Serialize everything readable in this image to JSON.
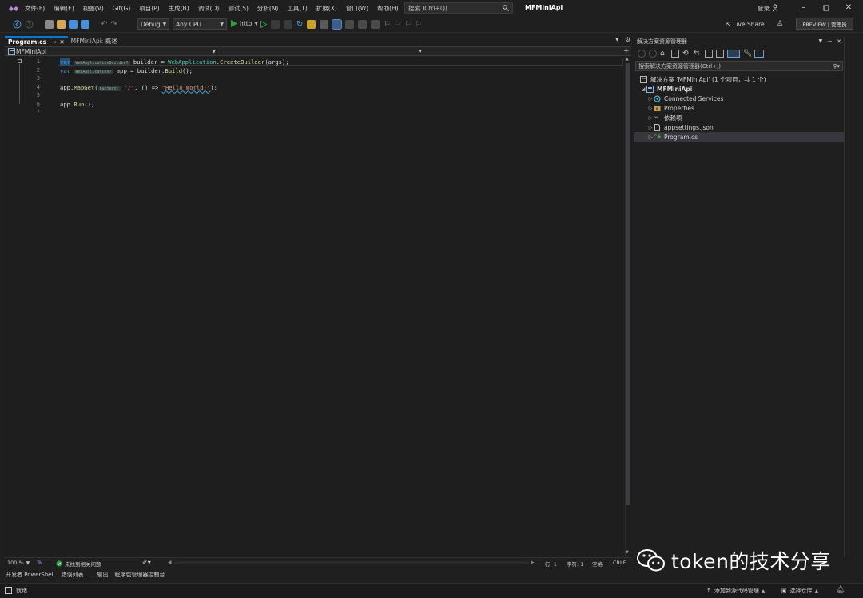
{
  "menu": [
    "文件(F)",
    "编辑(E)",
    "视图(V)",
    "Git(G)",
    "项目(P)",
    "生成(B)",
    "调试(D)",
    "测试(S)",
    "分析(N)",
    "工具(T)",
    "扩展(X)",
    "窗口(W)",
    "帮助(H)"
  ],
  "search": {
    "label": "搜索 (Ctrl+Q)"
  },
  "window": {
    "title": "MFMiniApi",
    "login_label": "登录"
  },
  "toolbar": {
    "config": "Debug",
    "platform": "Any CPU",
    "run_profile": "http",
    "live_share": "Live Share",
    "preview": "PREVIEW | 管理员"
  },
  "editor": {
    "tabs": [
      {
        "label": "Program.cs",
        "active": true
      },
      {
        "label": "MFMiniApi: 概述",
        "active": false
      }
    ],
    "nav_project": "MFMiniApi",
    "line_numbers": [
      "1",
      "2",
      "3",
      "4",
      "5",
      "6",
      "7"
    ],
    "code": {
      "l1_var": "var",
      "l1_hint": "WebApplicationBuilder?",
      "l1_rest_a": " builder = ",
      "l1_cls": "WebApplication",
      "l1_rest_b": ".",
      "l1_fn": "CreateBuilder",
      "l1_rest_c": "(args);",
      "l2_var": "var",
      "l2_hint": "WebApplication?",
      "l2_rest": " app = builder.",
      "l2_fn": "Build",
      "l2_end": "();",
      "l4_a": "app.",
      "l4_fn": "MapGet",
      "l4_b": "(",
      "l4_hint": "pattern:",
      "l4_str1": " \"/\"",
      "l4_c": ", () => ",
      "l4_str2": "\"Hello World!\"",
      "l4_d": ");",
      "l6_a": "app.",
      "l6_fn": "Run",
      "l6_b": "();"
    },
    "status": {
      "zoom": "100 %",
      "issues": "未找到相关问题",
      "line": "行: 1",
      "char": "字符: 1",
      "whitespace": "空格",
      "eol": "CRLF"
    }
  },
  "bottom_tabs": [
    "开发者 PowerShell",
    "错误列表 ...",
    "输出",
    "程序包管理器控制台"
  ],
  "statusbar": {
    "ready": "就绪",
    "add_source": "添加到源代码管理",
    "select_repo": "选择仓库"
  },
  "solution_explorer": {
    "title": "解决方案资源管理器",
    "search_placeholder": "搜索解决方案资源管理器(Ctrl+;)",
    "solution_label": "解决方案 'MFMiniApi' (1 个项目，共 1 个)",
    "items": [
      {
        "label": "MFMiniApi",
        "icon": "project-icon"
      },
      {
        "label": "Connected Services",
        "icon": "connected-services-icon"
      },
      {
        "label": "Properties",
        "icon": "properties-icon"
      },
      {
        "label": "依赖项",
        "icon": "dependencies-icon"
      },
      {
        "label": "appsettings.json",
        "icon": "json-file-icon"
      },
      {
        "label": "Program.cs",
        "icon": "csharp-file-icon"
      }
    ]
  },
  "watermark": {
    "text": "token的技术分享"
  },
  "colors": {
    "accent": "#0078d4",
    "run_green": "#2ea043",
    "keyword": "#569cd6",
    "type": "#4ec9b0",
    "string": "#d69d85"
  }
}
